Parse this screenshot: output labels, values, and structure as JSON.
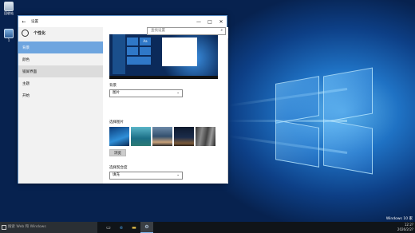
{
  "desktop": {
    "icons": [
      {
        "label": "回收站",
        "icon": "recycle-bin-icon"
      },
      {
        "label": "1",
        "icon": "computer-icon"
      }
    ],
    "watermark": "Windows 10 家"
  },
  "window": {
    "title": "设置",
    "controls": {
      "minimize": "—",
      "maximize": "□",
      "close": "✕"
    },
    "back": "←",
    "search_placeholder": "查找设置",
    "sidebar": {
      "header": "个性化",
      "items": [
        {
          "label": "背景",
          "selected": true
        },
        {
          "label": "颜色"
        },
        {
          "label": "锁屏界面",
          "hover": true
        },
        {
          "label": "主题"
        },
        {
          "label": "开始"
        }
      ]
    },
    "preview_tile_text": "Aa",
    "background": {
      "label": "背景",
      "value": "图片"
    },
    "choose_picture": {
      "label": "选择图片"
    },
    "browse_label": "浏览",
    "fit": {
      "label": "选择契合度",
      "value": "填充"
    }
  },
  "taskbar": {
    "search_placeholder": "搜索 Web 和 Windows",
    "clock_time": "12:2?",
    "clock_date": "2026/2/2?"
  },
  "colors": {
    "accent": "#6ea5df",
    "taskbar": "#101418"
  }
}
